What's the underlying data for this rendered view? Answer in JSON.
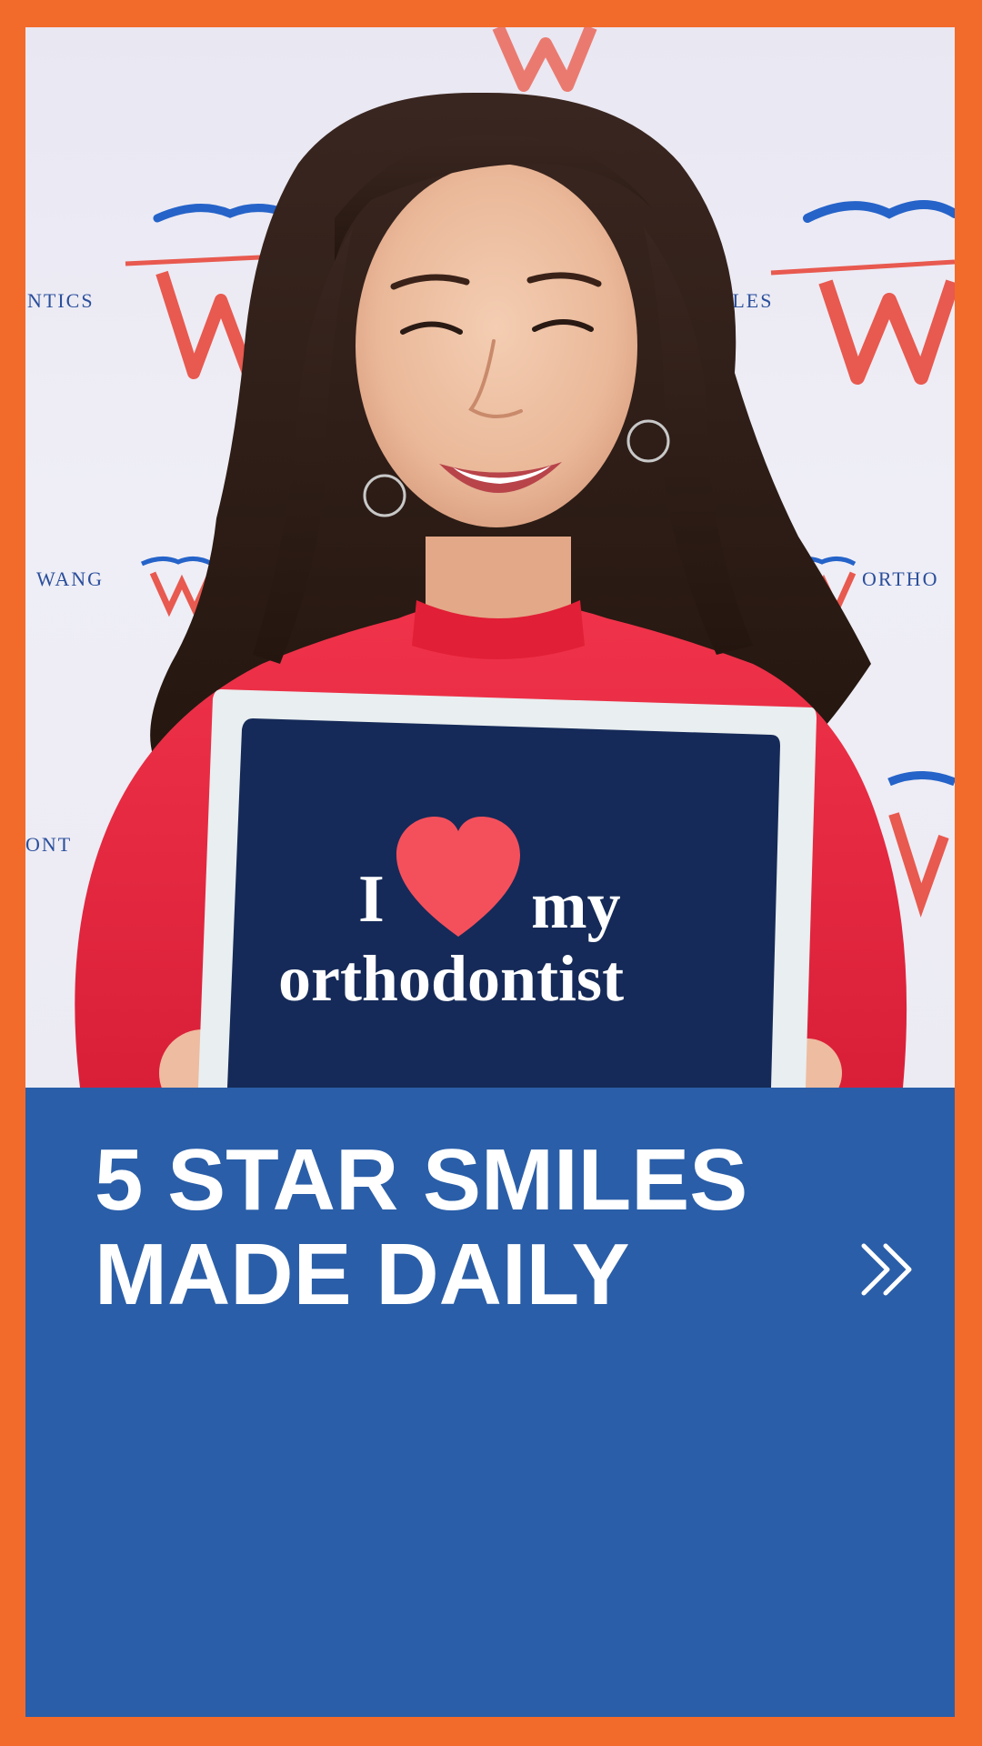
{
  "photo": {
    "alt": "Smiling patient holding an I love my orthodontist sign",
    "backdrop_labels": {
      "left_top": "NTICS",
      "mid_top": "ILES",
      "left_mid": "WANG",
      "right_mid": "ORTHO",
      "left_bottom": "ONT"
    },
    "sign": {
      "word_i": "I",
      "word_my": "my",
      "word_orthodontist": "orthodontist"
    }
  },
  "cta": {
    "headline_line1": "5 STAR SMILES",
    "headline_line2": "MADE DAILY",
    "next_icon": "double-chevron-right-icon"
  },
  "colors": {
    "border": "#f26b2b",
    "panel": "#2a5ea8",
    "sign_board": "#152a58",
    "heart": "#f4505c",
    "sweater": "#e8283e",
    "logo_blue": "#2563c9",
    "logo_red": "#e8594f"
  }
}
